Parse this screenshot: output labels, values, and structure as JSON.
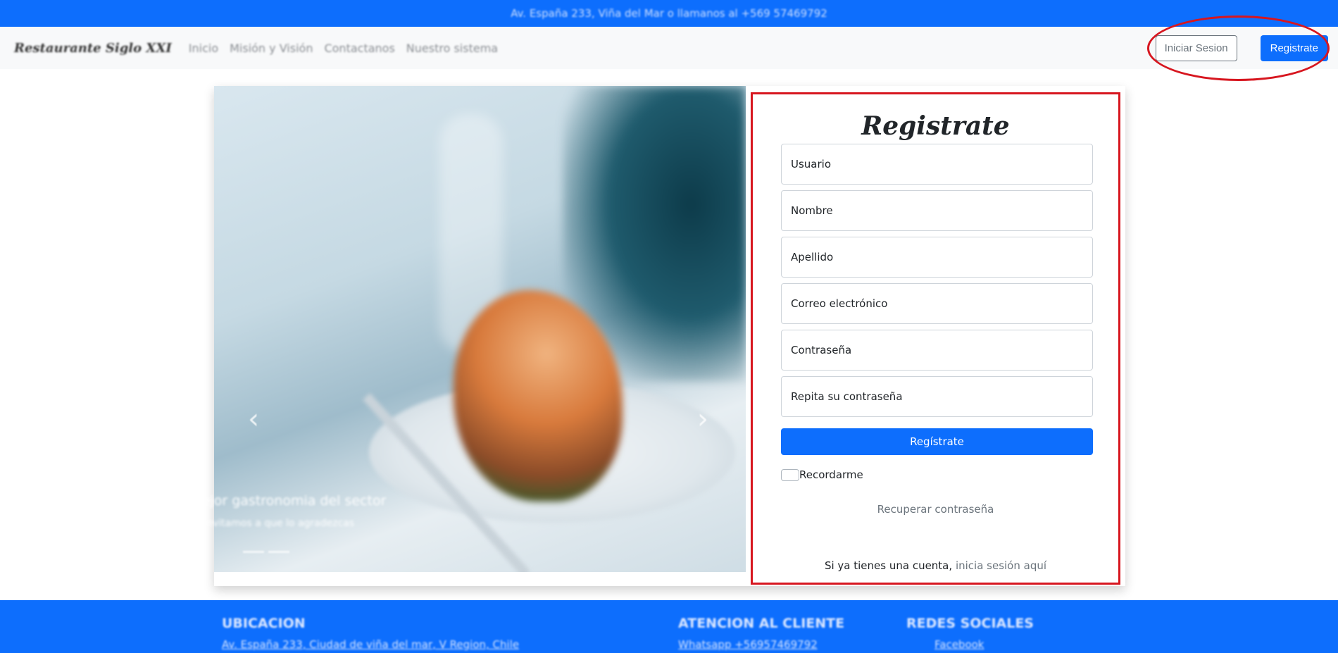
{
  "topbar": {
    "text": "Av. España 233, Viña del Mar o llamanos al +569 57469792"
  },
  "navbar": {
    "brand": "Restaurante Siglo XXI",
    "links": [
      "Inicio",
      "Misión y Visión",
      "Contactanos",
      "Nuestro sistema"
    ],
    "login_button": "Iniciar Sesion",
    "register_button": "Registrate"
  },
  "carousel": {
    "caption_title": "La mejor gastronomia del sector",
    "caption_text": "Te invitamos a que lo agradezcas",
    "prev_icon": "chevron-left-icon",
    "next_icon": "chevron-right-icon"
  },
  "form": {
    "title": "Registrate",
    "fields": {
      "usuario": "Usuario",
      "nombre": "Nombre",
      "apellido": "Apellido",
      "correo": "Correo electrónico",
      "contrasena": "Contraseña",
      "repetir": "Repita su contraseña"
    },
    "submit": "Regístrate",
    "remember": "Recordarme",
    "recover": "Recuperar contraseña",
    "login_prompt": "Si ya tienes una cuenta,",
    "login_link": "inicia sesión aquí"
  },
  "footer": {
    "ubicacion_title": "UBICACION",
    "ubicacion_text": "Av. España 233, Ciudad de viña del mar, V Region, Chile",
    "atencion_title": "ATENCION AL CLIENTE",
    "atencion_text": "Whatsapp +56957469792",
    "redes_title": "REDES SOCIALES",
    "redes_text": "Facebook"
  },
  "colors": {
    "primary": "#0d6efd",
    "annotation_red": "#d7161f",
    "navbar_bg": "#f8f9fa"
  }
}
